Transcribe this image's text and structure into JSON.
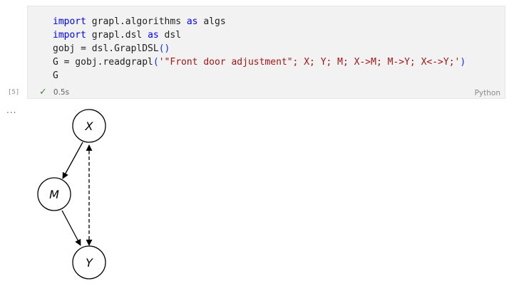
{
  "cell": {
    "execution_count": "[5]",
    "status_time": "0.5s",
    "language": "Python",
    "code": {
      "line1": {
        "kw1": "import",
        "mod": " grapl.algorithms ",
        "kw2": "as",
        "alias": " algs"
      },
      "line2": {
        "kw1": "import",
        "mod": " grapl.dsl ",
        "kw2": "as",
        "alias": " dsl"
      },
      "line3": {
        "pre": "gobj = dsl.GraplDSL",
        "paren": "()"
      },
      "line4": {
        "pre": "G = gobj.readgrapl",
        "open": "(",
        "str": "'\"Front door adjustment\"; X; Y; M; X->M; M->Y; X<->Y;'",
        "close": ")"
      },
      "line5": "G"
    }
  },
  "output": {
    "ellipsis": "...",
    "nodes": {
      "x": "X",
      "m": "M",
      "y": "Y"
    },
    "edges": [
      {
        "from": "X",
        "to": "M",
        "style": "solid"
      },
      {
        "from": "M",
        "to": "Y",
        "style": "solid"
      },
      {
        "from": "X",
        "to": "Y",
        "style": "dashed-bidirected"
      }
    ]
  },
  "colors": {
    "keyword": "#0000ff",
    "string": "#a31515",
    "success_check": "#388a34",
    "cell_background": "#f2f2f2"
  },
  "icons": {
    "status": "checkmark-icon"
  }
}
